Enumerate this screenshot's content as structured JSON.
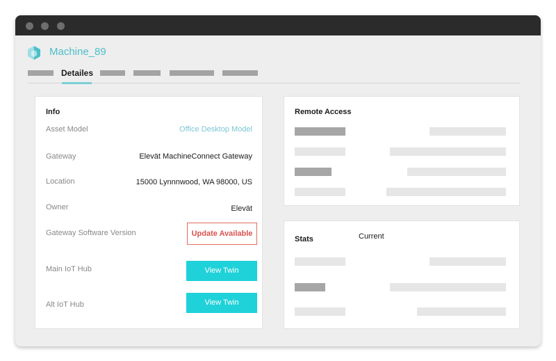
{
  "app": {
    "title": "Machine_89",
    "icon": "hexagon-icon",
    "accent_color": "#4bbfc9"
  },
  "tabs": {
    "active_label": "Detailes"
  },
  "info": {
    "title": "Info",
    "rows": [
      {
        "label": "Asset Model",
        "value": "Office Desktop Model"
      },
      {
        "label": "Gateway",
        "value": "Elevät MachineConnect Gateway"
      },
      {
        "label": "Location",
        "value": "15000 Lynnnwood, WA 98000, US"
      },
      {
        "label": "Owner",
        "value": "Elevät"
      },
      {
        "label": "Gateway Software Version",
        "action": "Update Available"
      },
      {
        "label": "Main IoT Hub",
        "action": "View Twin"
      },
      {
        "label": "Alt IoT Hub",
        "action": "View Twin"
      }
    ]
  },
  "remote_access": {
    "title": "Remote Access"
  },
  "stats": {
    "title": "Stats",
    "column": "Current"
  },
  "colors": {
    "button_cyan": "#1fd1d9",
    "update_red": "#d9534f"
  }
}
